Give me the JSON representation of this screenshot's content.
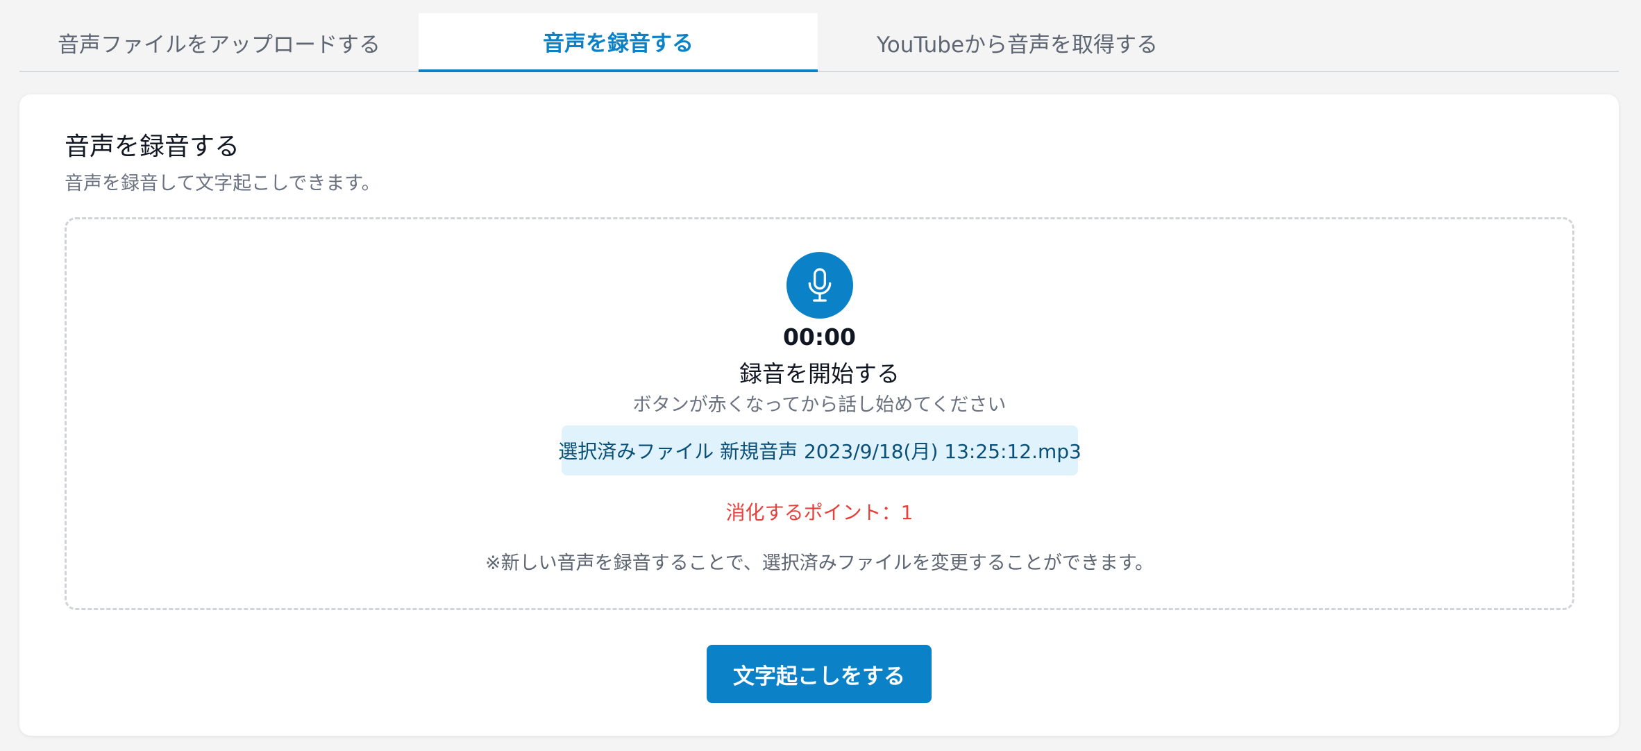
{
  "tabs": [
    {
      "label": "音声ファイルをアップロードする",
      "active": false
    },
    {
      "label": "音声を録音する",
      "active": true
    },
    {
      "label": "YouTubeから音声を取得する",
      "active": false
    }
  ],
  "card": {
    "title": "音声を録音する",
    "subtitle": "音声を録音して文字起こしできます。"
  },
  "recorder": {
    "icon": "microphone-icon",
    "timer": "00:00",
    "start_label": "録音を開始する",
    "hint": "ボタンが赤くなってから話し始めてください",
    "selected_file": "選択済みファイル 新規音声 2023/9/18(月) 13:25:12.mp3",
    "points": "消化するポイント：1",
    "note": "※新しい音声を録音することで、選択済みファイルを変更することができます。"
  },
  "actions": {
    "transcribe_label": "文字起こしをする"
  },
  "colors": {
    "accent": "#0b82c8",
    "points_text": "#e5413c",
    "file_pill_bg": "#e0f2fc"
  }
}
